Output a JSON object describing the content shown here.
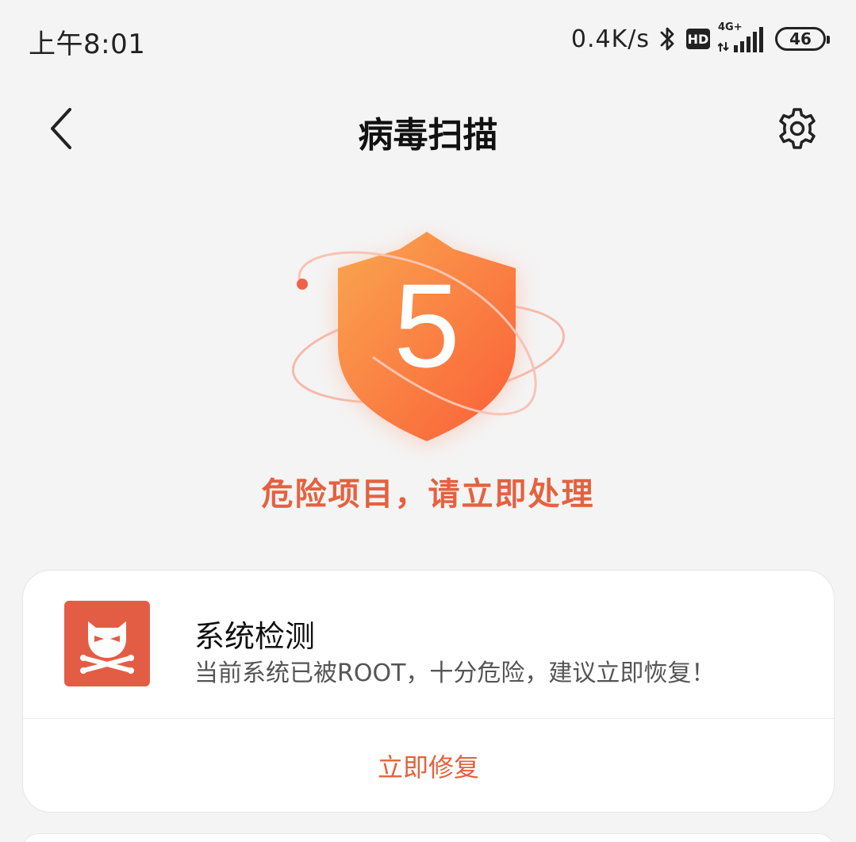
{
  "status_bar": {
    "time": "上午8:01",
    "net_speed": "0.4K/s",
    "hd_label": "HD",
    "network_type": "4G+",
    "battery": "46"
  },
  "header": {
    "title": "病毒扫描",
    "back_icon": "chevron-left-icon",
    "settings_icon": "gear-icon"
  },
  "scan_result": {
    "count": "5",
    "message": "危险项目，请立即处理"
  },
  "items": [
    {
      "icon": "rooted-skull-icon",
      "title": "系统检测",
      "description": "当前系统已被ROOT，十分危险，建议立即恢复！",
      "action": "立即修复"
    }
  ],
  "colors": {
    "accent": "#e5613f",
    "shield_top": "#f8a24e",
    "shield_bottom": "#fb6a3a",
    "icon_bg": "#e35d45"
  }
}
